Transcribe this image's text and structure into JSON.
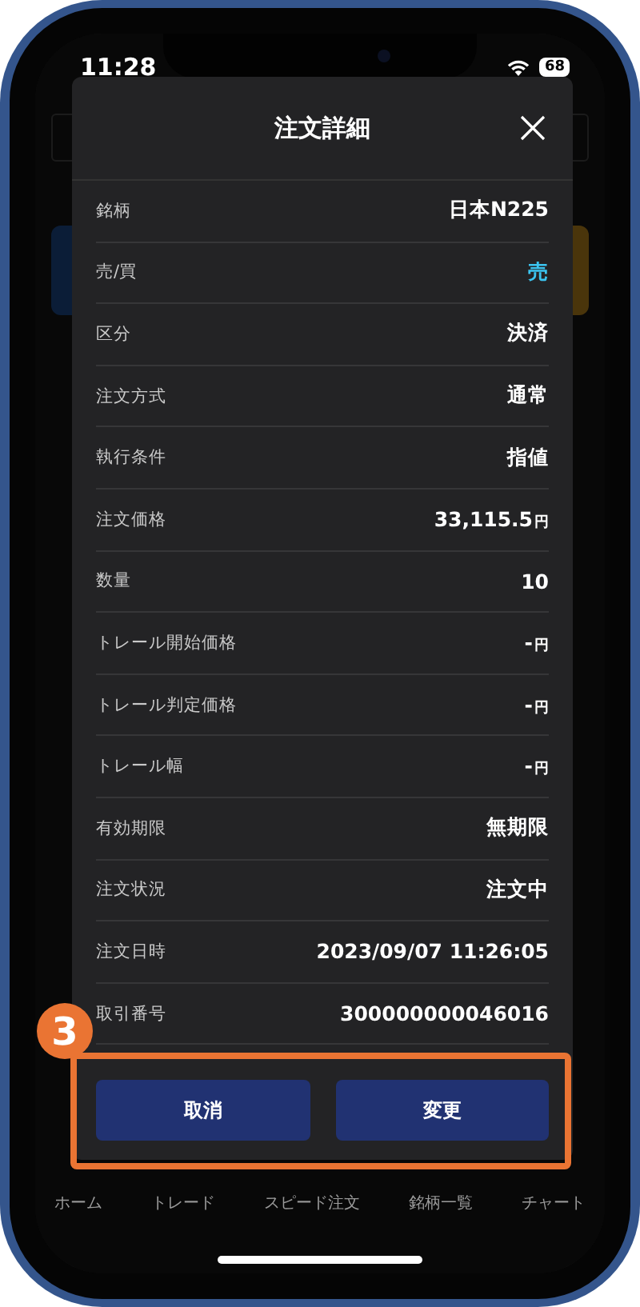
{
  "status_bar": {
    "time": "11:28",
    "battery": "68"
  },
  "background_nav": [
    "ホーム",
    "トレード",
    "スピード注文",
    "銘柄一覧",
    "チャート"
  ],
  "modal": {
    "title": "注文詳細",
    "rows": [
      {
        "label": "銘柄",
        "value": "日本N225"
      },
      {
        "label": "売/買",
        "value": "売",
        "color": "#3cc4f0"
      },
      {
        "label": "区分",
        "value": "決済"
      },
      {
        "label": "注文方式",
        "value": "通常"
      },
      {
        "label": "執行条件",
        "value": "指値"
      },
      {
        "label": "注文価格",
        "value": "33,115.5",
        "unit": "円"
      },
      {
        "label": "数量",
        "value": "10"
      },
      {
        "label": "トレール開始価格",
        "value": "-",
        "unit": "円"
      },
      {
        "label": "トレール判定価格",
        "value": "-",
        "unit": "円"
      },
      {
        "label": "トレール幅",
        "value": "-",
        "unit": "円"
      },
      {
        "label": "有効期限",
        "value": "無期限"
      },
      {
        "label": "注文状況",
        "value": "注文中"
      },
      {
        "label": "注文日時",
        "value": "2023/09/07 11:26:05"
      },
      {
        "label": "取引番号",
        "value": "300000000046016"
      }
    ],
    "buttons": [
      "取消",
      "変更"
    ]
  },
  "step_badge": "3"
}
